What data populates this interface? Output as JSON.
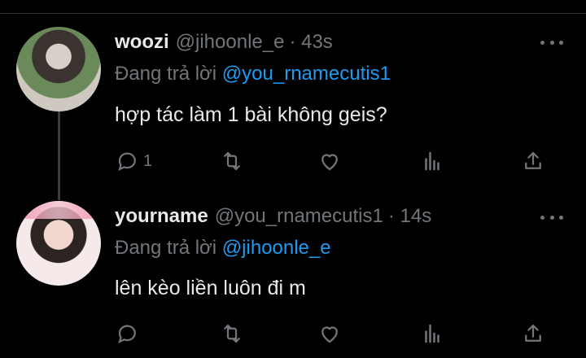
{
  "tweets": [
    {
      "name": "woozi",
      "handle": "@jihoonle_e",
      "time": "· 43s",
      "reply_prefix": "Đang trả lời",
      "reply_to": "@you_rnamecutis1",
      "text": "hợp tác làm 1 bài không geis?",
      "reply_count": "1"
    },
    {
      "name": "yourname",
      "handle": "@you_rnamecutis1",
      "time": "· 14s",
      "reply_prefix": "Đang trả lời",
      "reply_to": "@jihoonle_e",
      "text": "lên kèo liền luôn đi m",
      "reply_count": ""
    }
  ],
  "icons": {
    "reply": "reply-icon",
    "retweet": "retweet-icon",
    "like": "heart-icon",
    "views": "views-icon",
    "share": "share-icon",
    "more": "more-icon"
  },
  "colors": {
    "background": "#000000",
    "text": "#e7e9ea",
    "muted": "#71767b",
    "mention": "#1d9bf0"
  }
}
